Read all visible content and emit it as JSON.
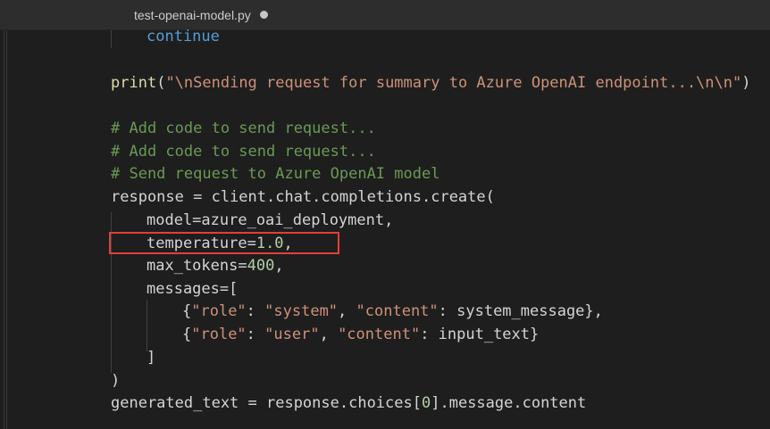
{
  "tab": {
    "filename": "test-openai-model.py",
    "modified": true
  },
  "code_lines": [
    {
      "tokens": [
        {
          "t": "continue",
          "c": "kw"
        }
      ]
    },
    {
      "tokens": []
    },
    {
      "tokens": [
        {
          "t": "print",
          "c": "fn"
        },
        {
          "t": "(",
          "c": "var"
        },
        {
          "t": "\"\\nSending request for summary to Azure OpenAI endpoint...\\n\\n\"",
          "c": "str"
        },
        {
          "t": ")",
          "c": "var"
        }
      ]
    },
    {
      "tokens": []
    },
    {
      "tokens": [
        {
          "t": "# Add code to send request...",
          "c": "cm"
        }
      ]
    },
    {
      "tokens": [
        {
          "t": "# Add code to send request...",
          "c": "cm"
        }
      ]
    },
    {
      "tokens": [
        {
          "t": "# Send request to Azure OpenAI model",
          "c": "cm"
        }
      ]
    },
    {
      "tokens": [
        {
          "t": "response = client.chat.completions.create(",
          "c": "var"
        }
      ]
    },
    {
      "tokens": [
        {
          "t": "model=azure_oai_deployment,",
          "c": "var"
        }
      ]
    },
    {
      "tokens": [
        {
          "t": "temperature=",
          "c": "var"
        },
        {
          "t": "1.0",
          "c": "num"
        },
        {
          "t": ",",
          "c": "var"
        }
      ]
    },
    {
      "tokens": [
        {
          "t": "max_tokens=",
          "c": "var"
        },
        {
          "t": "400",
          "c": "num"
        },
        {
          "t": ",",
          "c": "var"
        }
      ]
    },
    {
      "tokens": [
        {
          "t": "messages=[",
          "c": "var"
        }
      ]
    },
    {
      "tokens": [
        {
          "t": "{",
          "c": "var"
        },
        {
          "t": "\"role\"",
          "c": "str"
        },
        {
          "t": ": ",
          "c": "var"
        },
        {
          "t": "\"system\"",
          "c": "str"
        },
        {
          "t": ", ",
          "c": "var"
        },
        {
          "t": "\"content\"",
          "c": "str"
        },
        {
          "t": ": system_message},",
          "c": "var"
        }
      ]
    },
    {
      "tokens": [
        {
          "t": "{",
          "c": "var"
        },
        {
          "t": "\"role\"",
          "c": "str"
        },
        {
          "t": ": ",
          "c": "var"
        },
        {
          "t": "\"user\"",
          "c": "str"
        },
        {
          "t": ", ",
          "c": "var"
        },
        {
          "t": "\"content\"",
          "c": "str"
        },
        {
          "t": ": input_text}",
          "c": "var"
        }
      ]
    },
    {
      "tokens": [
        {
          "t": "]",
          "c": "var"
        }
      ]
    },
    {
      "tokens": [
        {
          "t": ")",
          "c": "var"
        }
      ]
    },
    {
      "tokens": [
        {
          "t": "generated_text = response.choices[",
          "c": "var"
        },
        {
          "t": "0",
          "c": "num"
        },
        {
          "t": "].message.content",
          "c": "var"
        }
      ]
    }
  ],
  "highlight": {
    "color": "#e0403a",
    "line": "temperature=1.0,"
  },
  "colors": {
    "background": "#1e1e1e",
    "keyword": "#569cd6",
    "function": "#dcdcaa",
    "string": "#ce9178",
    "comment": "#6a9955",
    "number": "#b5cea8",
    "text": "#d4d4d4"
  }
}
